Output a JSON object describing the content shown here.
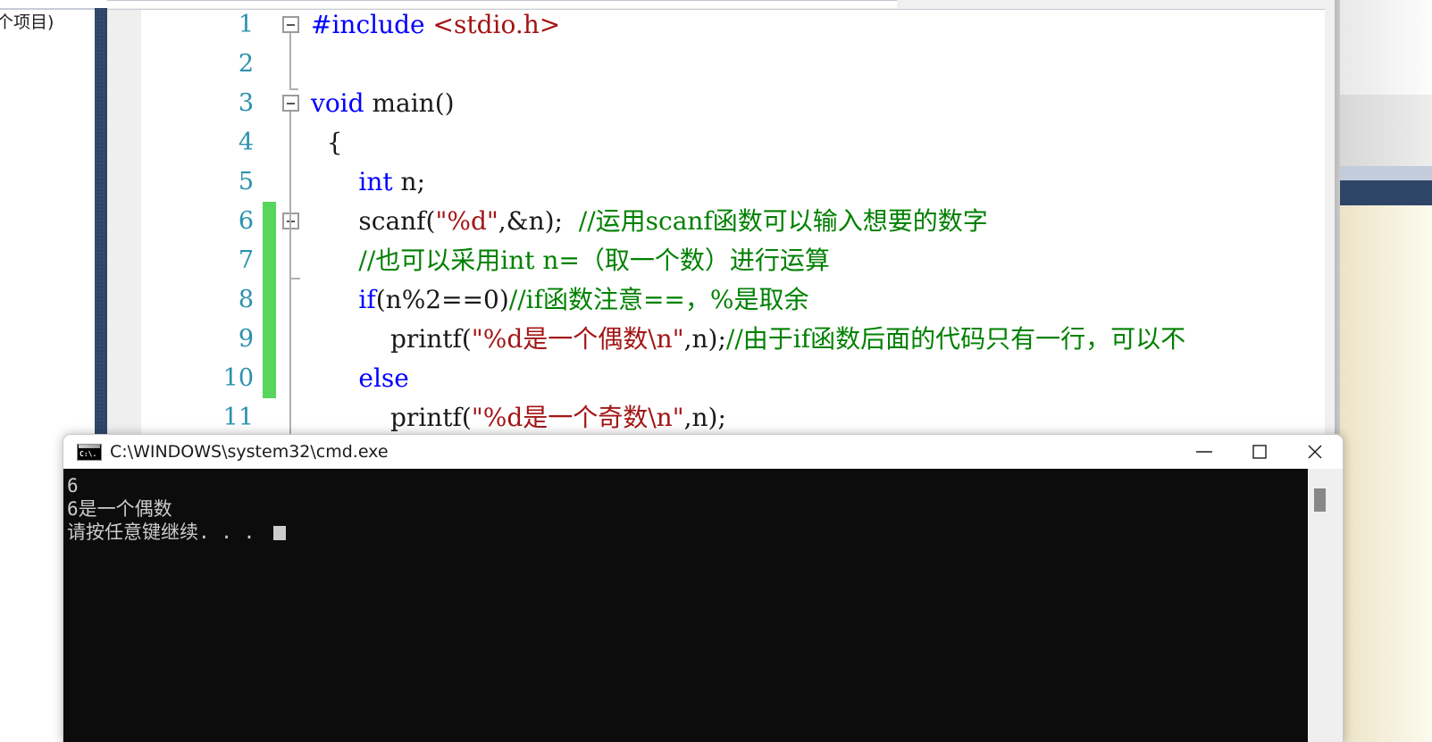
{
  "background": {
    "left_fragment_text": "个项目)"
  },
  "editor": {
    "lines": [
      {
        "number": "1",
        "changed": false,
        "fold": "open",
        "segments": [
          {
            "text": "#include ",
            "cls": "pp"
          },
          {
            "text": "<stdio.h>",
            "cls": "inc"
          }
        ]
      },
      {
        "number": "2",
        "changed": false,
        "fold": "none",
        "segments": []
      },
      {
        "number": "3",
        "changed": false,
        "fold": "open",
        "segments": [
          {
            "text": "void ",
            "cls": "kw"
          },
          {
            "text": "main()",
            "cls": "pl"
          }
        ]
      },
      {
        "number": "4",
        "changed": false,
        "fold": "none",
        "segments": [
          {
            "text": "  {",
            "cls": "pl"
          }
        ]
      },
      {
        "number": "5",
        "changed": false,
        "fold": "none",
        "segments": [
          {
            "text": "      ",
            "cls": "pl"
          },
          {
            "text": "int",
            "cls": "kw"
          },
          {
            "text": " n;",
            "cls": "pl"
          }
        ]
      },
      {
        "number": "6",
        "changed": true,
        "fold": "open",
        "segments": [
          {
            "text": "      scanf(",
            "cls": "pl"
          },
          {
            "text": "\"%d\"",
            "cls": "str"
          },
          {
            "text": ",&n);  ",
            "cls": "pl"
          },
          {
            "text": "//运用scanf函数可以输入想要的数字",
            "cls": "cmt"
          }
        ]
      },
      {
        "number": "7",
        "changed": true,
        "fold": "none",
        "segments": [
          {
            "text": "      ",
            "cls": "pl"
          },
          {
            "text": "//也可以采用int n=（取一个数）进行运算",
            "cls": "cmt"
          }
        ]
      },
      {
        "number": "8",
        "changed": true,
        "fold": "none",
        "segments": [
          {
            "text": "      ",
            "cls": "pl"
          },
          {
            "text": "if",
            "cls": "kw"
          },
          {
            "text": "(n%2==0)",
            "cls": "pl"
          },
          {
            "text": "//if函数注意==，%是取余",
            "cls": "cmt"
          }
        ]
      },
      {
        "number": "9",
        "changed": true,
        "fold": "none",
        "segments": [
          {
            "text": "          printf(",
            "cls": "pl"
          },
          {
            "text": "\"%d是一个偶数\\n\"",
            "cls": "str"
          },
          {
            "text": ",n);",
            "cls": "pl"
          },
          {
            "text": "//由于if函数后面的代码只有一行，可以不",
            "cls": "cmt"
          }
        ]
      },
      {
        "number": "10",
        "changed": true,
        "fold": "none",
        "segments": [
          {
            "text": "      ",
            "cls": "pl"
          },
          {
            "text": "else",
            "cls": "kw"
          }
        ]
      },
      {
        "number": "11",
        "changed": false,
        "fold": "none",
        "segments": [
          {
            "text": "          printf(",
            "cls": "pl"
          },
          {
            "text": "\"%d是一个奇数\\n\"",
            "cls": "str"
          },
          {
            "text": ",n);",
            "cls": "pl"
          }
        ]
      }
    ]
  },
  "cmd_window": {
    "icon_label": "C:\\.",
    "title": "C:\\WINDOWS\\system32\\cmd.exe",
    "minimize_label": "Minimize",
    "maximize_label": "Maximize",
    "close_label": "Close",
    "console_lines": [
      "6",
      "6是一个偶数",
      "请按任意键继续. . . "
    ]
  },
  "colors": {
    "navy_border": "#2f4568",
    "change_bar_green": "#57d65c",
    "line_number_blue": "#2b91af",
    "keyword_blue": "#0000ff",
    "string_red": "#a31515",
    "comment_green": "#008000",
    "console_background": "#0c0c0c",
    "console_text": "#cccccc"
  }
}
